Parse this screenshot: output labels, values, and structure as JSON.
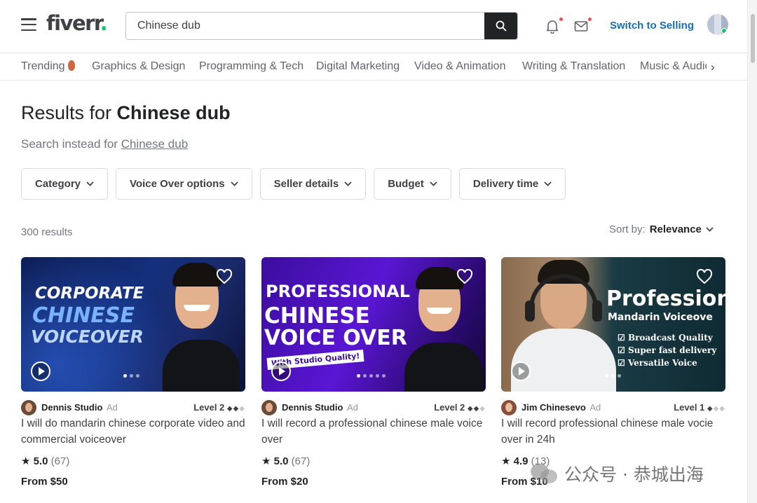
{
  "header": {
    "logo": "fiverr",
    "logo_dot": ".",
    "search_value": "Chinese dub",
    "switch_selling": "Switch to Selling"
  },
  "categories": [
    "Trending",
    "Graphics & Design",
    "Programming & Tech",
    "Digital Marketing",
    "Video & Animation",
    "Writing & Translation",
    "Music & Audio"
  ],
  "results": {
    "title_prefix": "Results for ",
    "query": "Chinese dub",
    "search_instead_prefix": "Search instead for ",
    "search_instead_link": "Chinese dub",
    "count": "300 results",
    "sort_label": "Sort by:",
    "sort_value": "Relevance"
  },
  "filters": [
    "Category",
    "Voice Over options",
    "Seller details",
    "Budget",
    "Delivery time"
  ],
  "gigs": [
    {
      "thumb_lines": [
        "CORPORATE",
        "CHINESE",
        "VOICEOVER"
      ],
      "seller": "Dennis Studio",
      "ad": "Ad",
      "level": "Level 2",
      "title": "I will do mandarin chinese corporate video and commercial voiceover",
      "rating": "5.0",
      "reviews": "(67)",
      "price": "From $50"
    },
    {
      "thumb_lines": [
        "PROFESSIONAL",
        "CHINESE",
        "VOICE OVER"
      ],
      "thumb_banner": "With Studio Quality!",
      "seller": "Dennis Studio",
      "ad": "Ad",
      "level": "Level 2",
      "title": "I will record a professional chinese male voice over",
      "rating": "5.0",
      "reviews": "(67)",
      "price": "From $20"
    },
    {
      "thumb_lines": [
        "Professional",
        "Mandarin Voiceove"
      ],
      "thumb_bullets": [
        "Broadcast Quality",
        "Super fast delivery",
        "Versatile Voice"
      ],
      "seller": "Jim Chinesevo",
      "ad": "Ad",
      "level": "Level 1",
      "title": "I will record professional chinese male vocie over in 24h",
      "rating": "4.9",
      "reviews": "(13)",
      "price": "From $10"
    }
  ],
  "watermark": "公众号 · 恭城出海",
  "colors": {
    "accent_green": "#1dbf73",
    "switch_blue": "#1a6fb4",
    "text_dark": "#222325"
  },
  "icons": [
    "menu-icon",
    "search-icon",
    "bell-icon",
    "mail-icon",
    "heart-icon",
    "play-icon",
    "star-icon",
    "chevron-down-icon",
    "chevron-right-icon"
  ]
}
